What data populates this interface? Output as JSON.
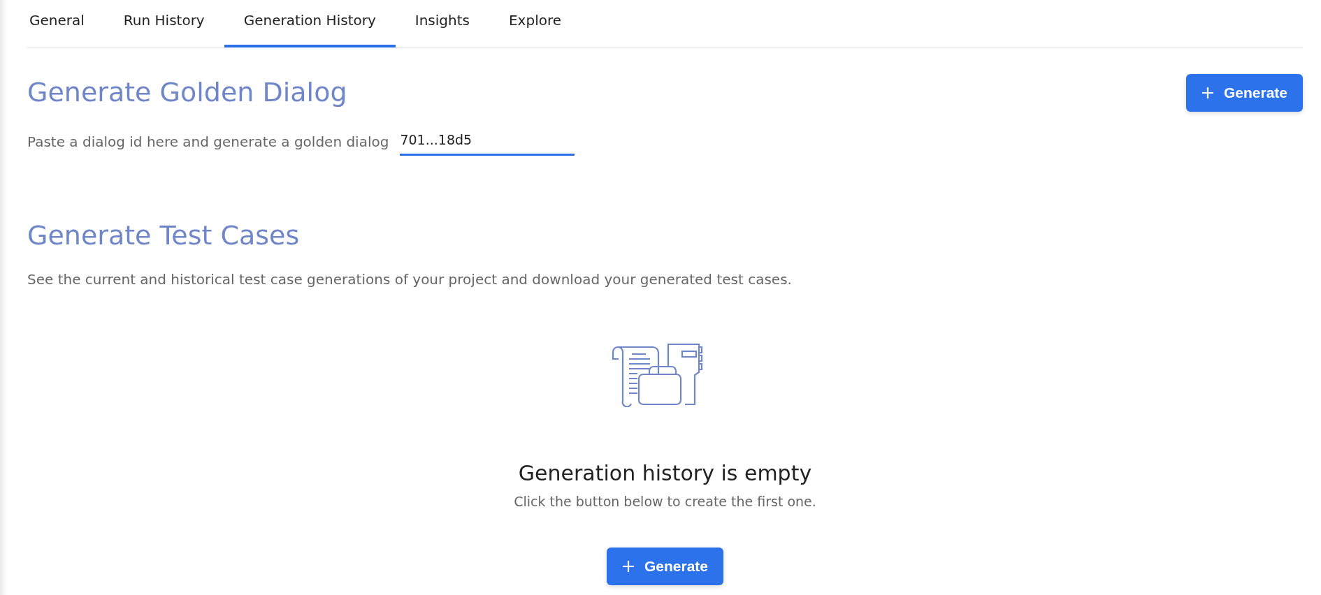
{
  "tabs": [
    {
      "label": "General",
      "selected": false
    },
    {
      "label": "Run History",
      "selected": false
    },
    {
      "label": "Generation History",
      "selected": true
    },
    {
      "label": "Insights",
      "selected": false
    },
    {
      "label": "Explore",
      "selected": false
    }
  ],
  "golden_dialog": {
    "title": "Generate Golden Dialog",
    "button": "Generate",
    "label": "Paste a dialog id here and generate a golden dialog",
    "value": "701...18d5"
  },
  "test_cases": {
    "title": "Generate Test Cases",
    "description": "See the current and historical test case generations of your project and download your generated test cases.",
    "empty_title": "Generation history is empty",
    "empty_subtitle": "Click the button below to create the first one.",
    "button": "Generate"
  }
}
